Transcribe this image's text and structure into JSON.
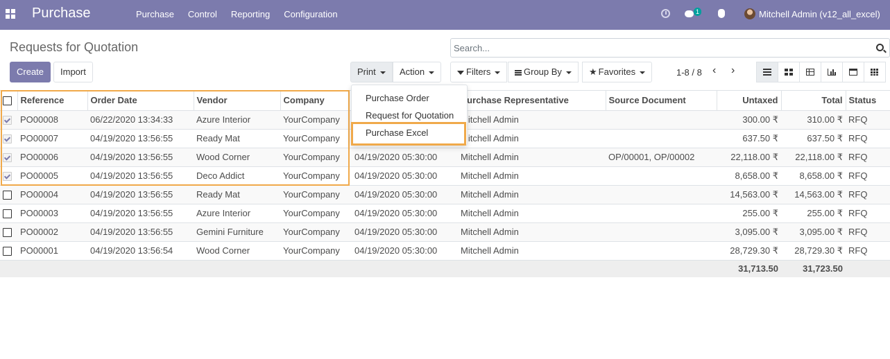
{
  "navbar": {
    "app_title": "Purchase",
    "menu": [
      "Purchase",
      "Control",
      "Reporting",
      "Configuration"
    ],
    "chat_count": "1",
    "user_name": "Mitchell Admin (v12_all_excel)",
    "color": "#7c7bad"
  },
  "control": {
    "page_title": "Requests for Quotation",
    "create_label": "Create",
    "import_label": "Import",
    "print_label": "Print",
    "action_label": "Action",
    "search_placeholder": "Search...",
    "filters_label": "Filters",
    "groupby_label": "Group By",
    "favorites_label": "Favorites",
    "pager": "1-8 / 8",
    "pager_prev": "‹",
    "pager_next": "›",
    "views": [
      "list-view-icon",
      "kanban-view-icon",
      "pivot-view-icon",
      "graph-view-icon",
      "calendar-view-icon",
      "grid-view-icon"
    ]
  },
  "print_menu": {
    "items": [
      "Purchase Order",
      "Request for Quotation",
      "Purchase Excel"
    ],
    "highlight_color": "#f0a94a"
  },
  "table": {
    "columns": [
      "Reference",
      "Order Date",
      "Vendor",
      "Company",
      "",
      "Purchase Representative",
      "Source Document",
      "Untaxed",
      "Total",
      "Status"
    ],
    "rows": [
      {
        "ref": "PO00008",
        "date": "06/22/2020 13:34:33",
        "vendor": "Azure Interior",
        "company": "YourCompany",
        "sched": "",
        "rep": "Mitchell Admin",
        "source": "",
        "untaxed": "300.00 ₹",
        "total": "310.00 ₹",
        "status": "RFQ",
        "checked": true
      },
      {
        "ref": "PO00007",
        "date": "04/19/2020 13:56:55",
        "vendor": "Ready Mat",
        "company": "YourCompany",
        "sched": "",
        "rep": "Mitchell Admin",
        "source": "",
        "untaxed": "637.50 ₹",
        "total": "637.50 ₹",
        "status": "RFQ",
        "checked": true
      },
      {
        "ref": "PO00006",
        "date": "04/19/2020 13:56:55",
        "vendor": "Wood Corner",
        "company": "YourCompany",
        "sched": "04/19/2020 05:30:00",
        "rep": "Mitchell Admin",
        "source": "OP/00001, OP/00002",
        "untaxed": "22,118.00 ₹",
        "total": "22,118.00 ₹",
        "status": "RFQ",
        "checked": true
      },
      {
        "ref": "PO00005",
        "date": "04/19/2020 13:56:55",
        "vendor": "Deco Addict",
        "company": "YourCompany",
        "sched": "04/19/2020 05:30:00",
        "rep": "Mitchell Admin",
        "source": "",
        "untaxed": "8,658.00 ₹",
        "total": "8,658.00 ₹",
        "status": "RFQ",
        "checked": true
      },
      {
        "ref": "PO00004",
        "date": "04/19/2020 13:56:55",
        "vendor": "Ready Mat",
        "company": "YourCompany",
        "sched": "04/19/2020 05:30:00",
        "rep": "Mitchell Admin",
        "source": "",
        "untaxed": "14,563.00 ₹",
        "total": "14,563.00 ₹",
        "status": "RFQ",
        "checked": false
      },
      {
        "ref": "PO00003",
        "date": "04/19/2020 13:56:55",
        "vendor": "Azure Interior",
        "company": "YourCompany",
        "sched": "04/19/2020 05:30:00",
        "rep": "Mitchell Admin",
        "source": "",
        "untaxed": "255.00 ₹",
        "total": "255.00 ₹",
        "status": "RFQ",
        "checked": false
      },
      {
        "ref": "PO00002",
        "date": "04/19/2020 13:56:55",
        "vendor": "Gemini Furniture",
        "company": "YourCompany",
        "sched": "04/19/2020 05:30:00",
        "rep": "Mitchell Admin",
        "source": "",
        "untaxed": "3,095.00 ₹",
        "total": "3,095.00 ₹",
        "status": "RFQ",
        "checked": false
      },
      {
        "ref": "PO00001",
        "date": "04/19/2020 13:56:54",
        "vendor": "Wood Corner",
        "company": "YourCompany",
        "sched": "04/19/2020 05:30:00",
        "rep": "Mitchell Admin",
        "source": "",
        "untaxed": "28,729.30 ₹",
        "total": "28,729.30 ₹",
        "status": "RFQ",
        "checked": false
      }
    ],
    "footer": {
      "untaxed": "31,713.50",
      "total": "31,723.50"
    }
  }
}
